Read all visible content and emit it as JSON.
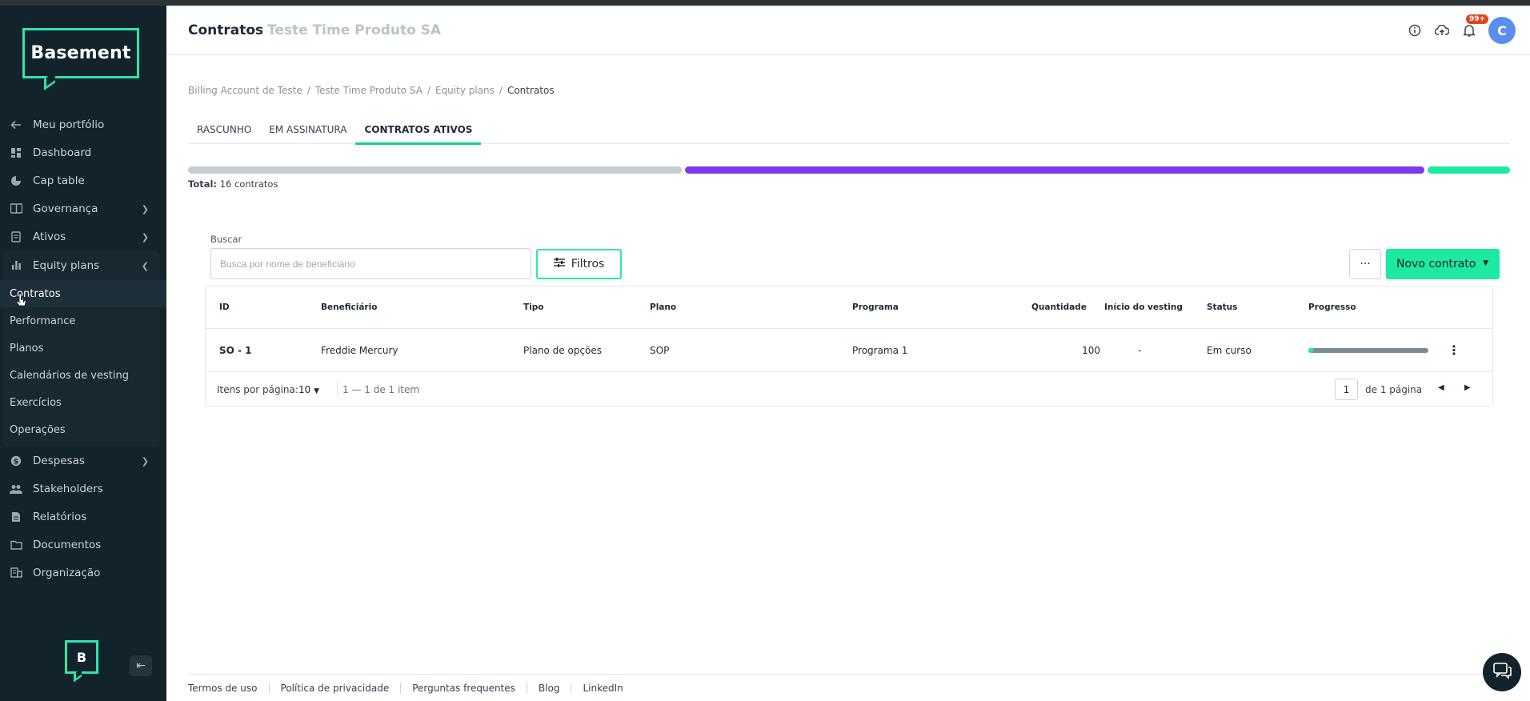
{
  "app": {
    "brand": "Basement",
    "brand_short": "B"
  },
  "header": {
    "title": "Contratos",
    "company": "Teste Time Produto SA",
    "notifications_badge": "99+",
    "avatar_initial": "C"
  },
  "sidebar": {
    "items_top": [
      {
        "label": "Meu portfólio",
        "icon": "arrow-left-icon"
      },
      {
        "label": "Dashboard",
        "icon": "dashboard-icon"
      },
      {
        "label": "Cap table",
        "icon": "pie-chart-icon"
      },
      {
        "label": "Governança",
        "icon": "book-icon"
      },
      {
        "label": "Ativos",
        "icon": "document-icon"
      }
    ],
    "equity": {
      "label": "Equity plans",
      "sub_items": [
        "Contratos",
        "Performance",
        "Planos",
        "Calendários de vesting",
        "Exercícios",
        "Operações"
      ]
    },
    "items_bottom": [
      {
        "label": "Despesas",
        "icon": "dollar-icon"
      },
      {
        "label": "Stakeholders",
        "icon": "people-icon"
      },
      {
        "label": "Relatórios",
        "icon": "report-icon"
      },
      {
        "label": "Documentos",
        "icon": "folder-icon"
      },
      {
        "label": "Organização",
        "icon": "building-icon"
      }
    ]
  },
  "breadcrumb": [
    "Billing Account de Teste",
    "Teste Time Produto SA",
    "Equity plans",
    "Contratos"
  ],
  "tabs": [
    "RASCUNHO",
    "EM ASSINATURA",
    "CONTRATOS ATIVOS"
  ],
  "status_bar": {
    "segments": [
      {
        "color": "#c5cfd1",
        "value": 6
      },
      {
        "color": "#7c3aed",
        "value": 9
      },
      {
        "color": "#1de9a1",
        "value": 1
      }
    ]
  },
  "total": {
    "label": "Total:",
    "value": "16 contratos"
  },
  "search": {
    "label": "Buscar",
    "placeholder": "Busca por nome de beneficiário"
  },
  "buttons": {
    "filters": "Filtros",
    "more": "···",
    "new_contract": "Novo contrato"
  },
  "table": {
    "columns": [
      "ID",
      "Beneficiário",
      "Tipo",
      "Plano",
      "Programa",
      "Quantidade",
      "Início do vesting",
      "Status",
      "Progresso"
    ],
    "rows": [
      {
        "id": "SO - 1",
        "beneficiary": "Freddie Mercury",
        "type": "Plano de opções",
        "plan": "SOP",
        "program": "Programa 1",
        "quantity": "100",
        "vesting_start": "-",
        "status": "Em curso",
        "progress": 0.04
      }
    ]
  },
  "pagination": {
    "per_page_label": "Itens por página:",
    "per_page": "10",
    "range": "1 — 1 de 1 item",
    "page": "1",
    "of_pages": "de 1 página"
  },
  "footer": [
    "Termos de uso",
    "Política de privacidade",
    "Perguntas frequentes",
    "Blog",
    "LinkedIn"
  ]
}
